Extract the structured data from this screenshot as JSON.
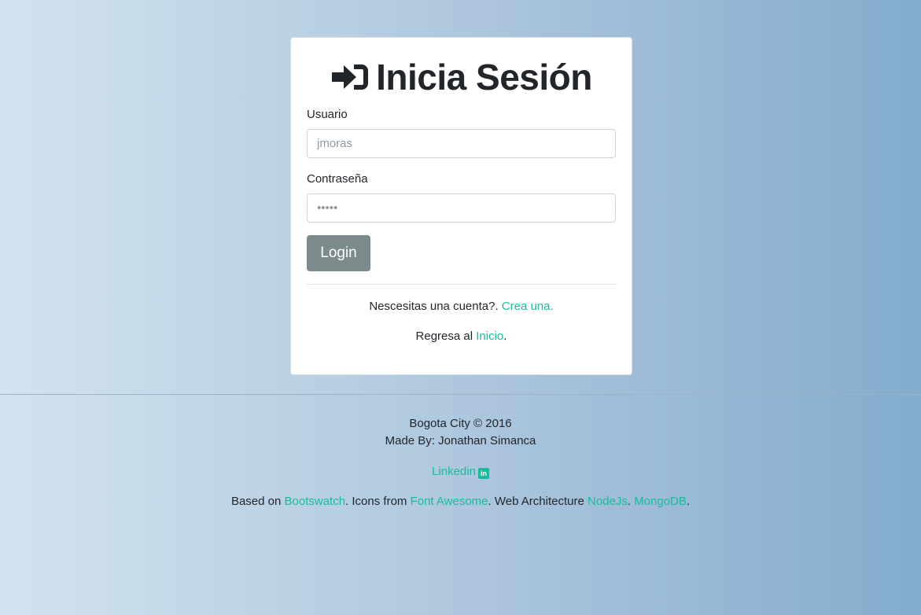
{
  "login": {
    "title": "Inicia Sesión",
    "title_icon": "sign-in-icon",
    "user_label": "Usuario",
    "user_placeholder": "jmoras",
    "password_label": "Contraseña",
    "password_placeholder": "•••••",
    "button_label": "Login",
    "signup_text": "Nescesitas una cuenta?. ",
    "signup_link": "Crea una.",
    "home_text": "Regresa al ",
    "home_link": "Inicio",
    "home_suffix": "."
  },
  "footer": {
    "copyright": "Bogota City © 2016",
    "made_by": "Made By: Jonathan Simanca",
    "linkedin_link": "Linkedin",
    "linkedin_icon": "linkedin-icon",
    "credits": {
      "based_on": "Based on ",
      "bootswatch": "Bootswatch",
      "icons_from": ". Icons from ",
      "font_awesome": "Font Awesome",
      "web_arch": ". Web Architecture ",
      "nodejs": "NodeJs",
      "sep": ". ",
      "mongodb": "MongoDB",
      "end": "."
    }
  },
  "colors": {
    "accent": "#18bc9c",
    "button": "#7b8a8b",
    "text": "#22262b"
  }
}
